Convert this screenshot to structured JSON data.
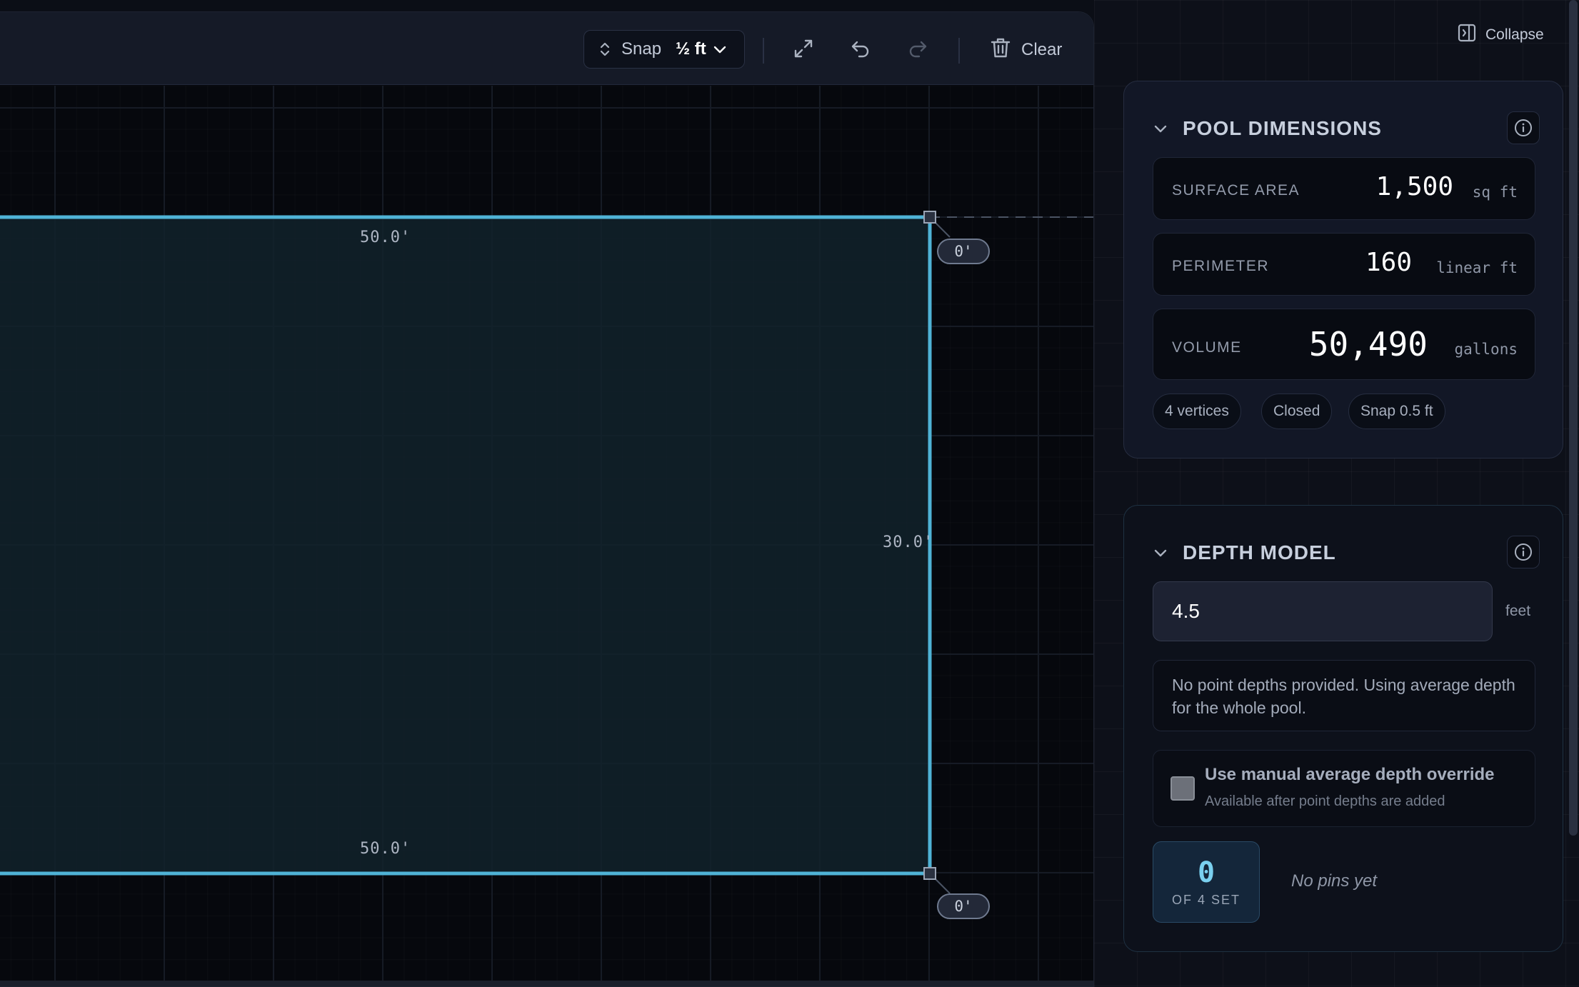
{
  "toolbar": {
    "snap_label": "Snap",
    "snap_value": "½ ft",
    "clear_label": "Clear",
    "icons": [
      "snap-updown-icon",
      "chevron-down-icon",
      "expand-icon",
      "undo-icon",
      "redo-icon",
      "trash-icon"
    ]
  },
  "canvas": {
    "top_edge": "50.0'",
    "bottom_edge": "50.0'",
    "right_edge": "30.0'",
    "depth_top_right": "0'",
    "depth_bottom_right": "0'",
    "colors": {
      "pool_stroke": "#4fb3d6",
      "pool_fill": "#12222c"
    }
  },
  "collapse_label": "Collapse",
  "dimensions": {
    "title": "POOL DIMENSIONS",
    "surface_area": {
      "label": "SURFACE AREA",
      "value": "1,500",
      "unit": "sq ft"
    },
    "perimeter": {
      "label": "PERIMETER",
      "value": "160",
      "unit": "linear ft"
    },
    "volume": {
      "label": "VOLUME",
      "value": "50,490",
      "unit": "gallons"
    },
    "chips": [
      "4 vertices",
      "Closed",
      "Snap 0.5 ft"
    ]
  },
  "depth": {
    "title": "DEPTH MODEL",
    "input_value": "4.5",
    "unit": "feet",
    "note": "No point depths provided. Using average depth for the whole pool.",
    "override_title": "Use manual average depth override",
    "override_sub": "Available after point depths are added",
    "pin_count": "0",
    "pin_of": "OF 4 SET",
    "no_pins": "No pins yet"
  }
}
